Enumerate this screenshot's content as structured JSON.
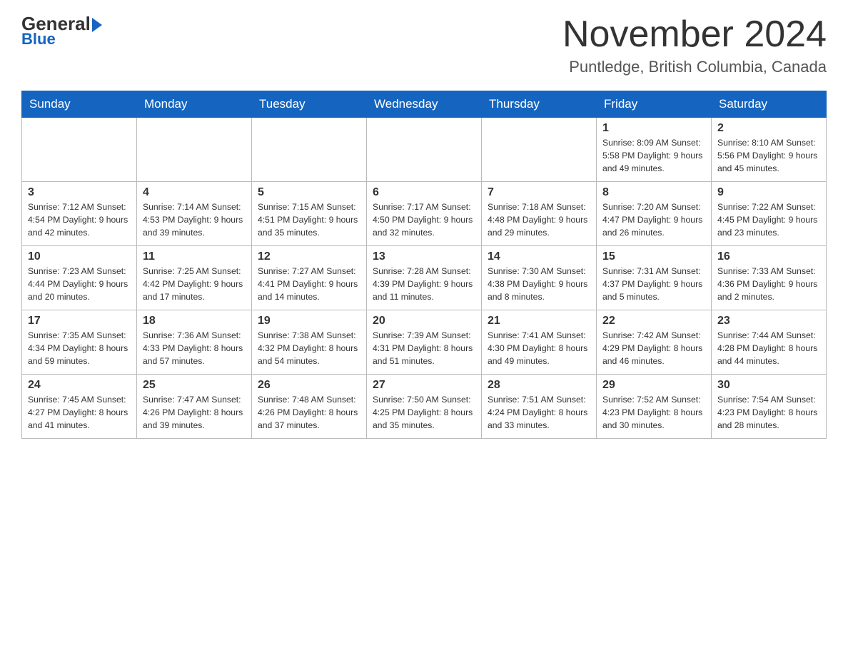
{
  "header": {
    "logo_general": "General",
    "logo_blue": "Blue",
    "month_title": "November 2024",
    "location": "Puntledge, British Columbia, Canada"
  },
  "weekdays": [
    "Sunday",
    "Monday",
    "Tuesday",
    "Wednesday",
    "Thursday",
    "Friday",
    "Saturday"
  ],
  "weeks": [
    [
      {
        "day": "",
        "info": ""
      },
      {
        "day": "",
        "info": ""
      },
      {
        "day": "",
        "info": ""
      },
      {
        "day": "",
        "info": ""
      },
      {
        "day": "",
        "info": ""
      },
      {
        "day": "1",
        "info": "Sunrise: 8:09 AM\nSunset: 5:58 PM\nDaylight: 9 hours\nand 49 minutes."
      },
      {
        "day": "2",
        "info": "Sunrise: 8:10 AM\nSunset: 5:56 PM\nDaylight: 9 hours\nand 45 minutes."
      }
    ],
    [
      {
        "day": "3",
        "info": "Sunrise: 7:12 AM\nSunset: 4:54 PM\nDaylight: 9 hours\nand 42 minutes."
      },
      {
        "day": "4",
        "info": "Sunrise: 7:14 AM\nSunset: 4:53 PM\nDaylight: 9 hours\nand 39 minutes."
      },
      {
        "day": "5",
        "info": "Sunrise: 7:15 AM\nSunset: 4:51 PM\nDaylight: 9 hours\nand 35 minutes."
      },
      {
        "day": "6",
        "info": "Sunrise: 7:17 AM\nSunset: 4:50 PM\nDaylight: 9 hours\nand 32 minutes."
      },
      {
        "day": "7",
        "info": "Sunrise: 7:18 AM\nSunset: 4:48 PM\nDaylight: 9 hours\nand 29 minutes."
      },
      {
        "day": "8",
        "info": "Sunrise: 7:20 AM\nSunset: 4:47 PM\nDaylight: 9 hours\nand 26 minutes."
      },
      {
        "day": "9",
        "info": "Sunrise: 7:22 AM\nSunset: 4:45 PM\nDaylight: 9 hours\nand 23 minutes."
      }
    ],
    [
      {
        "day": "10",
        "info": "Sunrise: 7:23 AM\nSunset: 4:44 PM\nDaylight: 9 hours\nand 20 minutes."
      },
      {
        "day": "11",
        "info": "Sunrise: 7:25 AM\nSunset: 4:42 PM\nDaylight: 9 hours\nand 17 minutes."
      },
      {
        "day": "12",
        "info": "Sunrise: 7:27 AM\nSunset: 4:41 PM\nDaylight: 9 hours\nand 14 minutes."
      },
      {
        "day": "13",
        "info": "Sunrise: 7:28 AM\nSunset: 4:39 PM\nDaylight: 9 hours\nand 11 minutes."
      },
      {
        "day": "14",
        "info": "Sunrise: 7:30 AM\nSunset: 4:38 PM\nDaylight: 9 hours\nand 8 minutes."
      },
      {
        "day": "15",
        "info": "Sunrise: 7:31 AM\nSunset: 4:37 PM\nDaylight: 9 hours\nand 5 minutes."
      },
      {
        "day": "16",
        "info": "Sunrise: 7:33 AM\nSunset: 4:36 PM\nDaylight: 9 hours\nand 2 minutes."
      }
    ],
    [
      {
        "day": "17",
        "info": "Sunrise: 7:35 AM\nSunset: 4:34 PM\nDaylight: 8 hours\nand 59 minutes."
      },
      {
        "day": "18",
        "info": "Sunrise: 7:36 AM\nSunset: 4:33 PM\nDaylight: 8 hours\nand 57 minutes."
      },
      {
        "day": "19",
        "info": "Sunrise: 7:38 AM\nSunset: 4:32 PM\nDaylight: 8 hours\nand 54 minutes."
      },
      {
        "day": "20",
        "info": "Sunrise: 7:39 AM\nSunset: 4:31 PM\nDaylight: 8 hours\nand 51 minutes."
      },
      {
        "day": "21",
        "info": "Sunrise: 7:41 AM\nSunset: 4:30 PM\nDaylight: 8 hours\nand 49 minutes."
      },
      {
        "day": "22",
        "info": "Sunrise: 7:42 AM\nSunset: 4:29 PM\nDaylight: 8 hours\nand 46 minutes."
      },
      {
        "day": "23",
        "info": "Sunrise: 7:44 AM\nSunset: 4:28 PM\nDaylight: 8 hours\nand 44 minutes."
      }
    ],
    [
      {
        "day": "24",
        "info": "Sunrise: 7:45 AM\nSunset: 4:27 PM\nDaylight: 8 hours\nand 41 minutes."
      },
      {
        "day": "25",
        "info": "Sunrise: 7:47 AM\nSunset: 4:26 PM\nDaylight: 8 hours\nand 39 minutes."
      },
      {
        "day": "26",
        "info": "Sunrise: 7:48 AM\nSunset: 4:26 PM\nDaylight: 8 hours\nand 37 minutes."
      },
      {
        "day": "27",
        "info": "Sunrise: 7:50 AM\nSunset: 4:25 PM\nDaylight: 8 hours\nand 35 minutes."
      },
      {
        "day": "28",
        "info": "Sunrise: 7:51 AM\nSunset: 4:24 PM\nDaylight: 8 hours\nand 33 minutes."
      },
      {
        "day": "29",
        "info": "Sunrise: 7:52 AM\nSunset: 4:23 PM\nDaylight: 8 hours\nand 30 minutes."
      },
      {
        "day": "30",
        "info": "Sunrise: 7:54 AM\nSunset: 4:23 PM\nDaylight: 8 hours\nand 28 minutes."
      }
    ]
  ]
}
